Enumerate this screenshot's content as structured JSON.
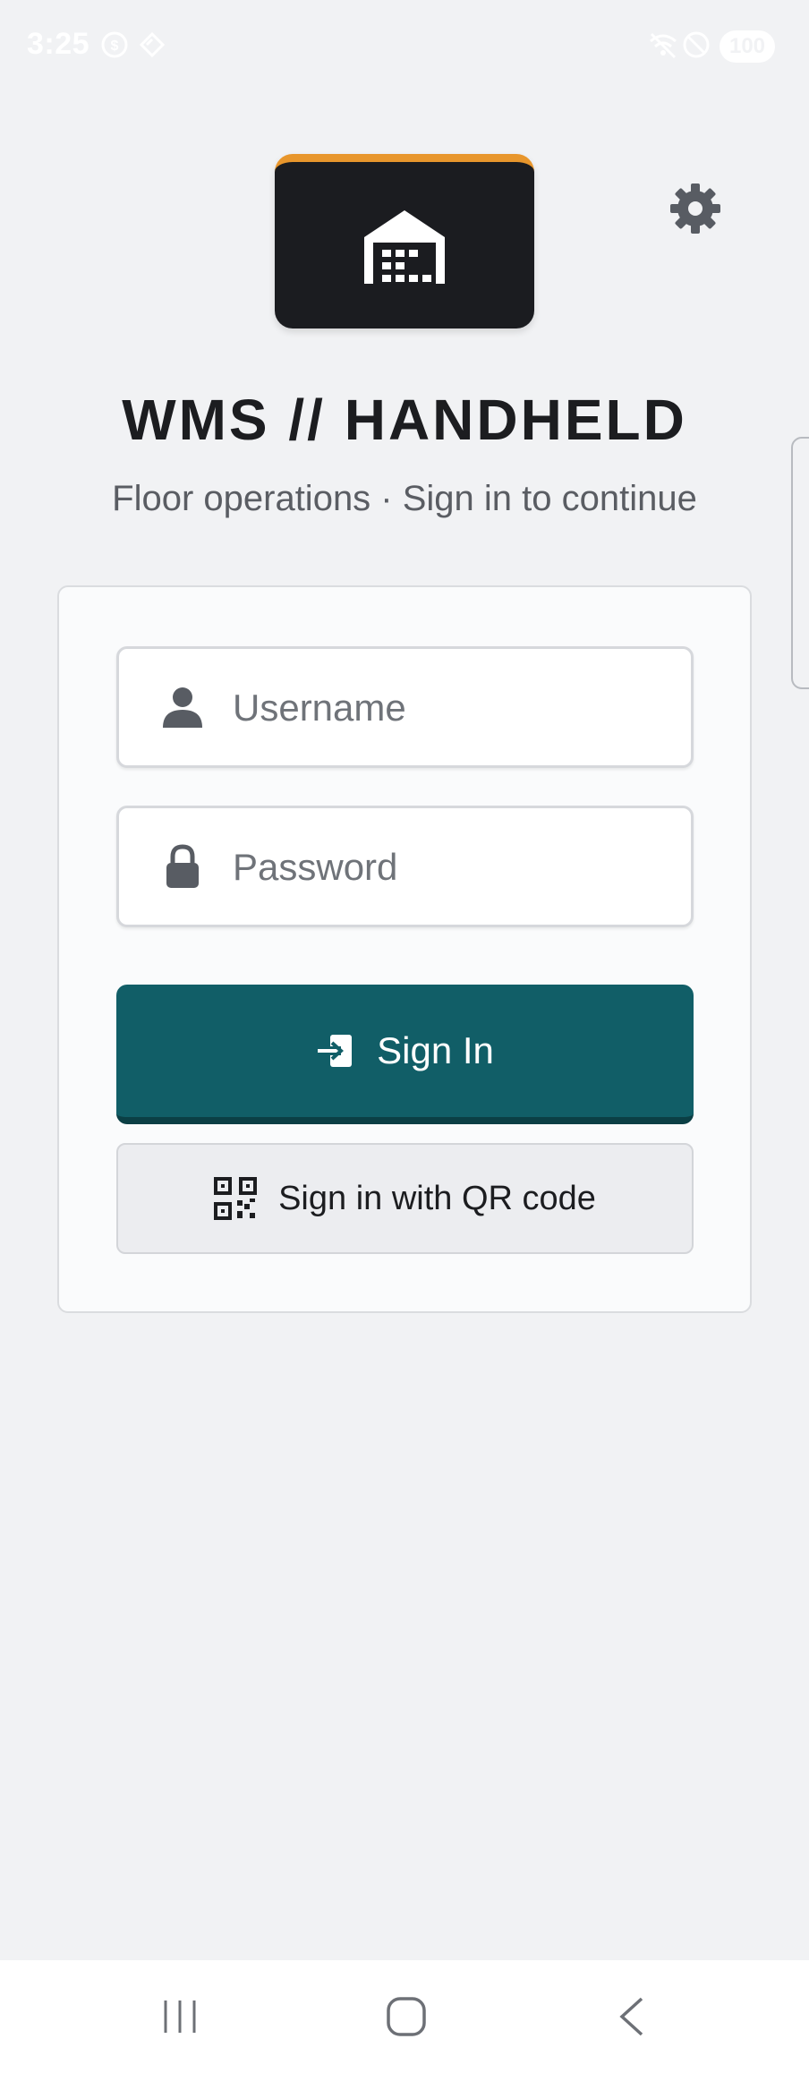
{
  "status_bar": {
    "time": "3:25",
    "battery": "100",
    "icons": [
      "currency-icon",
      "tag-icon",
      "wifi-off-icon",
      "do-not-disturb-icon",
      "battery-icon"
    ]
  },
  "header": {
    "logo_icon": "warehouse-icon",
    "settings_icon": "gear-icon",
    "title": "WMS // HANDHELD",
    "subtitle": "Floor operations · Sign in to continue",
    "accent_color": "#e8962c"
  },
  "login": {
    "username_placeholder": "Username",
    "password_placeholder": "Password",
    "username_icon": "user-icon",
    "password_icon": "lock-icon",
    "signin_label": "Sign In",
    "signin_icon": "sign-in-icon",
    "signin_color": "#115e67",
    "qr_label": "Sign in with QR code",
    "qr_icon": "qr-code-icon"
  },
  "nav_bar": {
    "buttons": [
      "recent-apps-icon",
      "home-icon",
      "back-icon"
    ]
  }
}
